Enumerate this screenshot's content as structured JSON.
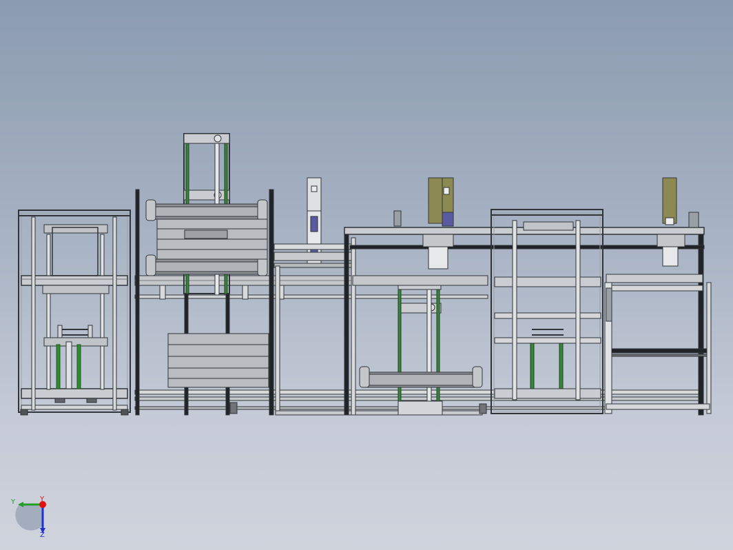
{
  "viewport": {
    "background_top": "#8b9bb0",
    "background_bottom": "#cfd3dc"
  },
  "model": {
    "frame_color": "#303438",
    "panel_color": "#b9bcc0",
    "rail_color": "#d8dadc",
    "accent_green": "#2e8b2e",
    "cylinder_olive": "#8c8a52",
    "cylinder_blue": "#5a5aa0"
  },
  "triad": {
    "x_axis_color": "#20a020",
    "y_axis_color": "#e01010",
    "z_axis_color": "#2030d0",
    "labels": {
      "y": "Y",
      "x": "Y",
      "z": "Z"
    }
  }
}
